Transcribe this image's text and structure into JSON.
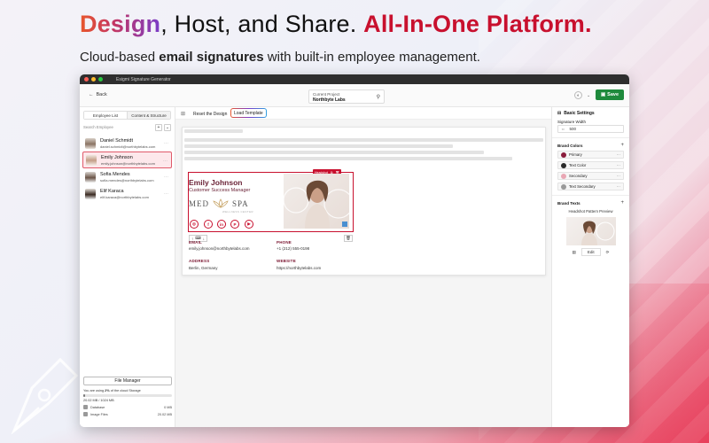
{
  "hero": {
    "title_word": "Design",
    "title_mid": ", Host, and Share. ",
    "title_bold": "All-In-One Platform.",
    "sub_pre": "Cloud-based ",
    "sub_bold": "email signatures",
    "sub_post": " with built-in employee management."
  },
  "window": {
    "title": "Esigmi Signature Generator"
  },
  "toolbar": {
    "back_label": "Back",
    "project_label": "Current Project",
    "project_value": "Northbyte Labs",
    "save_label": "Save"
  },
  "sidebar": {
    "tabs": [
      "Employee List",
      "Content & Structure"
    ],
    "search_placeholder": "Search Employee",
    "employees": [
      {
        "name": "Daniel Schmidt",
        "email": "daniel.schmidt@northbytelabs.com"
      },
      {
        "name": "Emily Johnson",
        "email": "emily.johnson@northbytelabs.com"
      },
      {
        "name": "Sofia Mendes",
        "email": "sofia.mendes@northbytelabs.com"
      },
      {
        "name": "Elif Karaca",
        "email": "elif.karaca@northbytelabs.com"
      }
    ],
    "file_manager": {
      "button": "File Manager",
      "note_pre": "You are using ",
      "note_pct": "2%",
      "note_post": " of the cloud Storage",
      "usage_fraction": 0.02,
      "usage": "20.02 MB / 1024 MB",
      "rows": [
        {
          "label": "Database",
          "size": "0 MB"
        },
        {
          "label": "Image Files",
          "size": "20.02 MB"
        }
      ]
    }
  },
  "editor": {
    "reset_label": "Reset the Design",
    "load_label": "Load Template",
    "signature": {
      "toolbar_label": "Headshot",
      "name": "Emily Johnson",
      "role": "Customer Success Manager",
      "logo_left": "MED",
      "logo_right": "SPA",
      "logo_sub": "WELLNESS CENTER",
      "socials": [
        "instagram",
        "facebook",
        "linkedin",
        "pinterest",
        "youtube"
      ],
      "social_glyphs": [
        "◎",
        "f",
        "in",
        "P",
        "▶"
      ]
    },
    "info": {
      "email_label": "EMAIL",
      "email_value": "emily.johnson@northbytelabs.com",
      "phone_label": "PHONE",
      "phone_value": "+1 (212) 555-0198",
      "address_label": "ADDRESS",
      "address_value": "Berlin, Germany",
      "website_label": "WEBSITE",
      "website_value": "https://northbytelabs.com"
    }
  },
  "settings": {
    "header": "Basic Settings",
    "width_label": "Signature Width",
    "width_value": "500",
    "brand_colors_label": "Brand Colors",
    "colors": [
      {
        "name": "Primary",
        "hex": "#8a1c3c"
      },
      {
        "name": "Text Color",
        "hex": "#2a2a2a"
      },
      {
        "name": "Secondary",
        "hex": "#e9a7b4"
      },
      {
        "name": "Text Secondary",
        "hex": "#9a9a9a"
      }
    ],
    "brand_texts_label": "Brand Texts",
    "preview_title": "Headshot Pattern Preview",
    "preview_edit": "Edit"
  },
  "colors": {
    "accent": "#c8102e",
    "save": "#1e8a3c"
  }
}
